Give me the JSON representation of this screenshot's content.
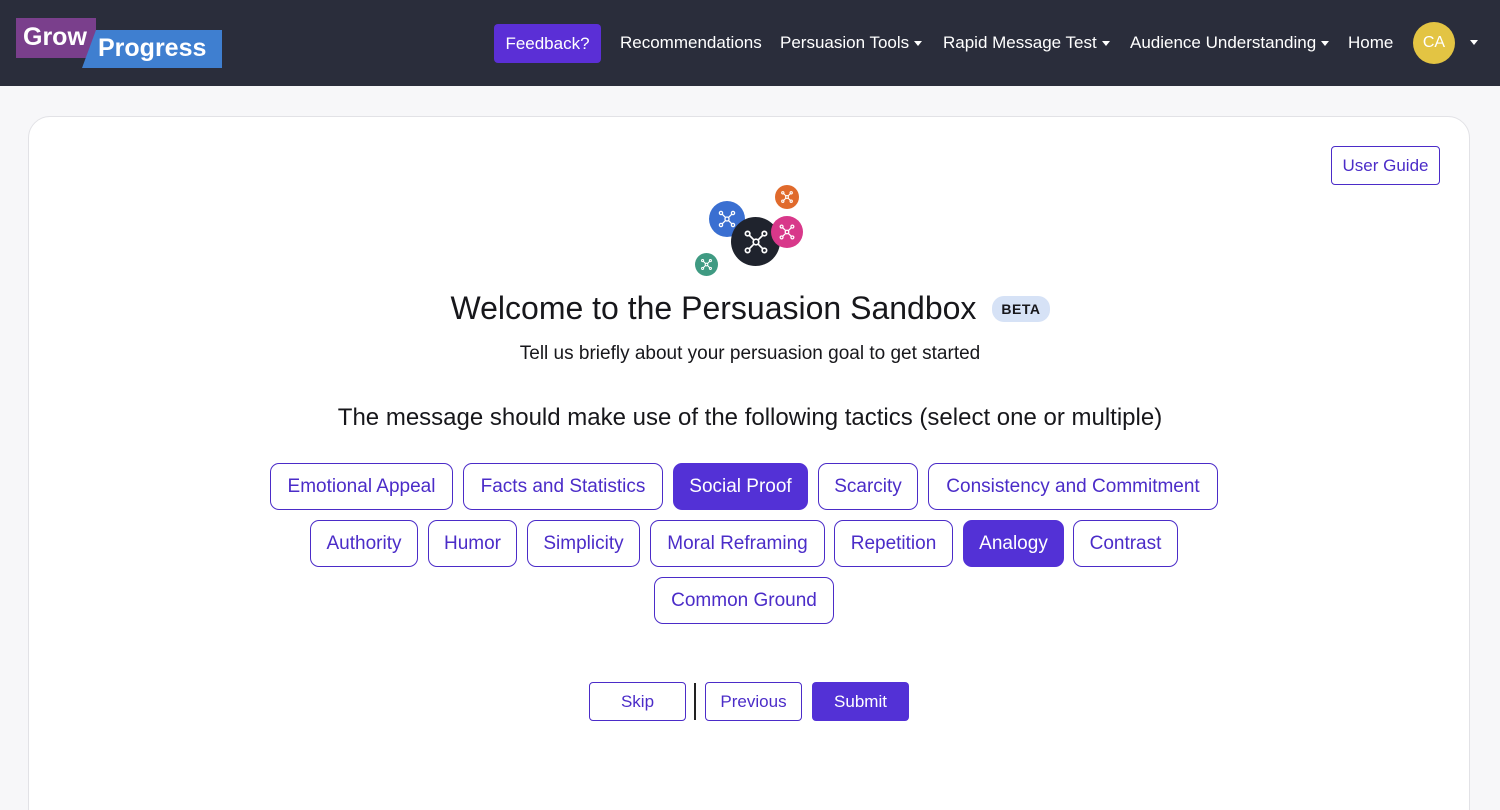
{
  "navbar": {
    "logo": {
      "word1": "Grow",
      "word2": "Progress"
    },
    "feedback_label": "Feedback?",
    "links": [
      {
        "label": "Recommendations",
        "dropdown": false
      },
      {
        "label": "Persuasion Tools",
        "dropdown": true
      },
      {
        "label": "Rapid Message Test",
        "dropdown": true
      },
      {
        "label": "Audience Understanding",
        "dropdown": true
      },
      {
        "label": "Home",
        "dropdown": false
      }
    ],
    "avatar_initials": "CA"
  },
  "main": {
    "user_guide_label": "User Guide",
    "title": "Welcome to the Persuasion Sandbox",
    "badge": "BETA",
    "subtitle": "Tell us briefly about your persuasion goal to get started",
    "instruction": "The message should make use of the following tactics (select one or multiple)",
    "tactics": [
      {
        "label": "Emotional Appeal",
        "selected": false
      },
      {
        "label": "Facts and Statistics",
        "selected": false
      },
      {
        "label": "Social Proof",
        "selected": true
      },
      {
        "label": "Scarcity",
        "selected": false
      },
      {
        "label": "Consistency and Commitment",
        "selected": false
      },
      {
        "label": "Authority",
        "selected": false
      },
      {
        "label": "Humor",
        "selected": false
      },
      {
        "label": "Simplicity",
        "selected": false
      },
      {
        "label": "Moral Reframing",
        "selected": false
      },
      {
        "label": "Repetition",
        "selected": false
      },
      {
        "label": "Analogy",
        "selected": true
      },
      {
        "label": "Contrast",
        "selected": false
      },
      {
        "label": "Common Ground",
        "selected": false
      }
    ],
    "actions": {
      "skip": "Skip",
      "previous": "Previous",
      "submit": "Submit"
    }
  },
  "colors": {
    "navbar_bg": "#2a2d3b",
    "accent": "#5331d6",
    "avatar": "#e3c443",
    "bubble_blue": "#3a6fd1",
    "bubble_dark": "#1f232d",
    "bubble_pink": "#d8388a",
    "bubble_orange": "#e06a2c",
    "bubble_teal": "#3f9a82"
  }
}
